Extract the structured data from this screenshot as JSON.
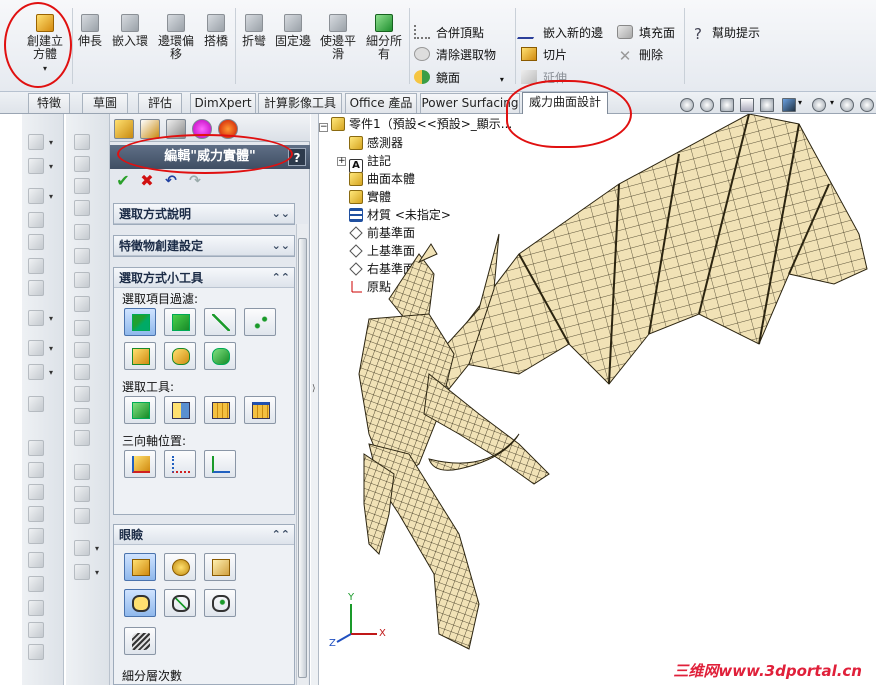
{
  "ribbon": {
    "large_buttons": [
      {
        "id": "create-solid",
        "label": "創建立方體"
      },
      {
        "id": "extend",
        "label": "伸長"
      },
      {
        "id": "embed-ring",
        "label": "嵌入環"
      },
      {
        "id": "edge-offset",
        "label": "邊環偏移"
      },
      {
        "id": "bridge",
        "label": "搭橋"
      },
      {
        "id": "fold",
        "label": "折彎"
      },
      {
        "id": "fix-edge",
        "label": "固定邊"
      },
      {
        "id": "smooth-edge",
        "label": "使邊平滑"
      },
      {
        "id": "subdivide-all",
        "label": "細分所有"
      }
    ],
    "small_col1": [
      "合併頂點",
      "清除選取物",
      "鏡面"
    ],
    "small_col2": [
      "嵌入新的邊",
      "切片",
      "延伸"
    ],
    "small_col3": [
      "填充面",
      "刪除"
    ],
    "help_label": "幫助提示"
  },
  "tabs": [
    "特徵",
    "草圖",
    "評估",
    "DimXpert",
    "計算影像工具",
    "Office 產品",
    "Power Surfacing",
    "威力曲面設計"
  ],
  "active_tab": "威力曲面設計",
  "property_manager": {
    "title": "編輯\"威力實體\"",
    "help": "?",
    "groups": {
      "selection_desc": "選取方式說明",
      "feature_settings": "特徵物創建設定",
      "selection_tools": "選取方式小工具",
      "display": "眼瞼"
    },
    "labels": {
      "filter": "選取項目過濾:",
      "tools": "選取工具:",
      "triad": "三向軸位置:",
      "subdiv": "細分層次數"
    }
  },
  "tree": {
    "root": "零件1（預設<<預設>_顯示...",
    "items": [
      "感測器",
      "註記",
      "曲面本體",
      "實體",
      "材質 <未指定>",
      "前基準面",
      "上基準面",
      "右基準面",
      "原點"
    ]
  },
  "axes": {
    "x": "X",
    "y": "Y",
    "z": "Z"
  },
  "watermark": "三维网www.3dportal.cn",
  "colors": {
    "annotation": "#e01010",
    "accent": "#3f4e63",
    "model_fill": "#f1e2b6"
  }
}
